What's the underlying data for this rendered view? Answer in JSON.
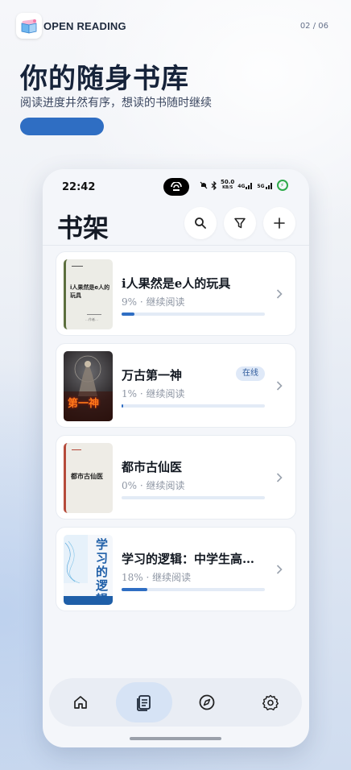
{
  "top": {
    "app_name": "OPEN READING",
    "page_indicator": "02 / 06"
  },
  "hero": {
    "title": "你的随身书库",
    "subtitle": "阅读进度井然有序，想读的书随时继续"
  },
  "status_bar": {
    "time": "22:42",
    "net_speed_value": "50.0",
    "net_speed_unit": "KB/S",
    "signal1_label": "4G",
    "signal2_label": "5G"
  },
  "shelf": {
    "title": "书架",
    "buttons": [
      "search-icon",
      "filter-icon",
      "plus-icon"
    ]
  },
  "books": [
    {
      "title": "i人果然是e人的玩具",
      "meta": "9% · 继续阅读",
      "progress": 0.09,
      "cover_text": "i人果然是e人的玩具",
      "cover_author": "…作者…",
      "cover_color": "#ecece6",
      "cover_spine": "#5c6f3e",
      "badge": ""
    },
    {
      "title": "万古第一神",
      "meta": "1% · 继续阅读",
      "progress": 0.01,
      "cover_text": "第一神",
      "badge": "在线"
    },
    {
      "title": "都市古仙医",
      "meta": "0% · 继续阅读",
      "progress": 0.0,
      "cover_text": "都市古仙医",
      "cover_color": "#eeece6",
      "cover_spine": "#b54a3a",
      "badge": ""
    },
    {
      "title": "学习的逻辑：中学生高效学习指南",
      "meta": "18% · 继续阅读",
      "progress": 0.18,
      "cover_text": "学习的逻辑",
      "badge": ""
    }
  ],
  "nav": {
    "items": [
      "home-icon",
      "bookshelf-icon",
      "compass-icon",
      "gear-icon"
    ],
    "active_index": 1
  },
  "colors": {
    "accent": "#2f6ec3",
    "progress_track": "#e3ebf6",
    "nav_active": "#d6e3f5"
  }
}
